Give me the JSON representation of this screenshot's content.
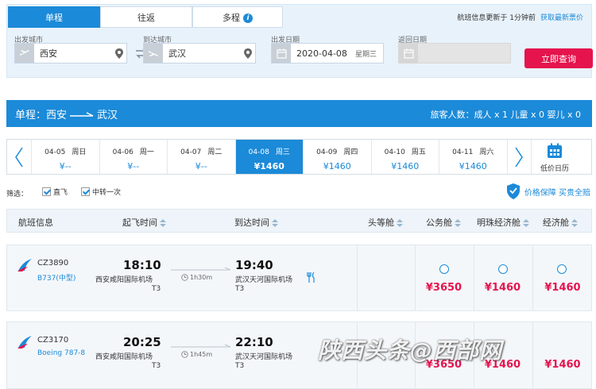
{
  "search": {
    "tabs": [
      "单程",
      "往返",
      "多程"
    ],
    "info_icon_glyph": "i",
    "update_note": "航班信息更新于 1分钟前",
    "refresh_link": "获取最新票价",
    "from_label": "出发城市",
    "from_value": "西安",
    "to_label": "到达城市",
    "to_value": "武汉",
    "depart_label": "出发日期",
    "depart_value": "2020-04-08",
    "depart_weekday": "星期三",
    "return_label": "返回日期",
    "return_value": "",
    "search_button": "立即查询"
  },
  "route": {
    "trip_type": "单程：",
    "origin": "西安",
    "destination": "武汉",
    "passengers": "旅客人数：成人 x 1 儿童 x 0 婴儿 x 0"
  },
  "dates": [
    {
      "date": "04-05",
      "weekday": "周日",
      "price": "¥--"
    },
    {
      "date": "04-06",
      "weekday": "周一",
      "price": "¥--"
    },
    {
      "date": "04-07",
      "weekday": "周二",
      "price": "¥--"
    },
    {
      "date": "04-08",
      "weekday": "周三",
      "price": "¥1460",
      "active": true
    },
    {
      "date": "04-09",
      "weekday": "周四",
      "price": "¥1460"
    },
    {
      "date": "04-10",
      "weekday": "周五",
      "price": "¥1460"
    },
    {
      "date": "04-11",
      "weekday": "周六",
      "price": "¥1460"
    }
  ],
  "calendar_label": "低价日历",
  "filters": {
    "label": "筛选：",
    "direct": "直飞",
    "transfer": "中转一次",
    "price_guarantee": "价格保障 买贵全赔"
  },
  "table": {
    "headers": [
      "航班信息",
      "起飞时间",
      "到达时间",
      "头等舱",
      "公务舱",
      "明珠经济舱",
      "经济舱"
    ]
  },
  "flights": [
    {
      "flight_no": "CZ3890",
      "aircraft": "B737(中型)",
      "dep_time": "18:10",
      "dep_airport": "西安咸阳国际机场",
      "dep_terminal": "T3",
      "duration": "1h30m",
      "arr_time": "19:40",
      "arr_airport": "武汉天河国际机场",
      "arr_terminal": "T3",
      "meal": true,
      "prices": [
        "",
        "¥3650",
        "¥1460",
        "¥1460"
      ]
    },
    {
      "flight_no": "CZ3170",
      "aircraft": "Boeing 787-8",
      "dep_time": "20:25",
      "dep_airport": "西安咸阳国际机场",
      "dep_terminal": "T3",
      "duration": "1h45m",
      "arr_time": "22:10",
      "arr_airport": "武汉天河国际机场",
      "arr_terminal": "T3",
      "meal": false,
      "prices": [
        "",
        "¥3650",
        "¥1460",
        "¥1460"
      ]
    }
  ],
  "watermark": "陕西头条@西部网",
  "colors": {
    "primary": "#1b8ad8",
    "accent": "#e5144d"
  }
}
